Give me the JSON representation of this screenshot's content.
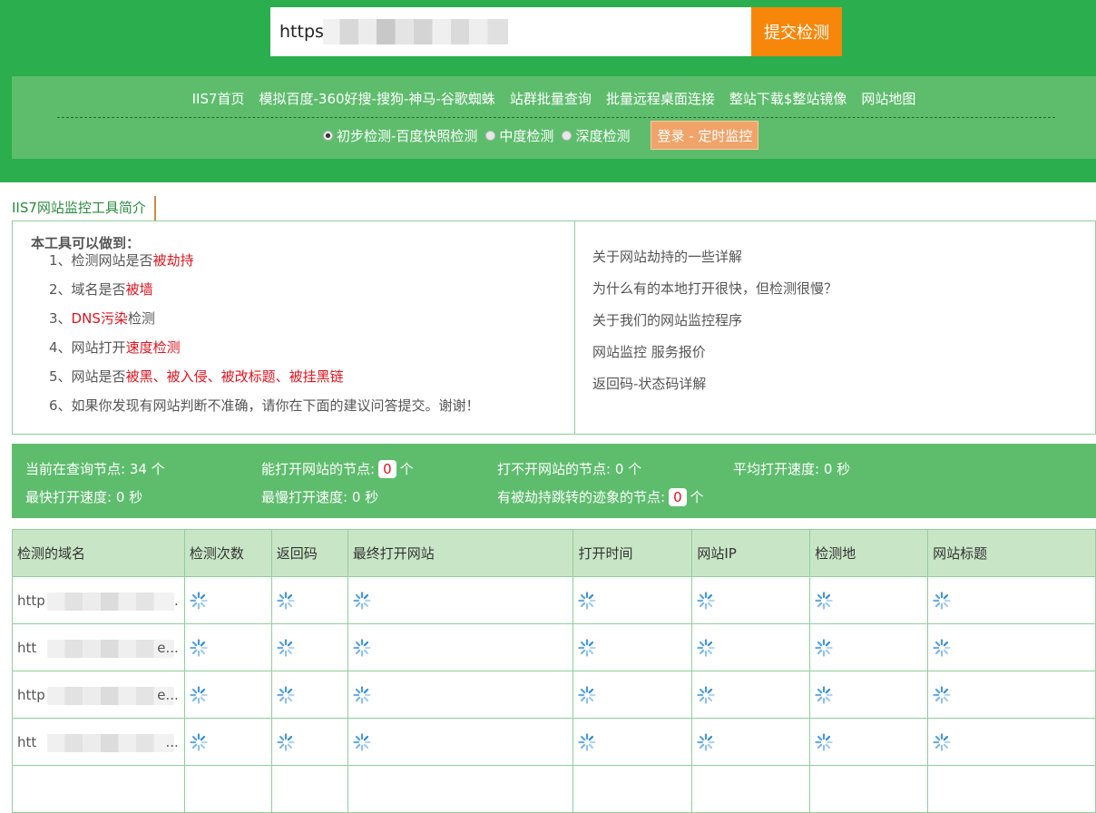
{
  "search": {
    "value": "https:",
    "submit_label": "提交检测"
  },
  "nav": {
    "links": [
      "IIS7首页",
      "模拟百度-360好搜-搜狗-神马-谷歌蜘蛛",
      "站群批量查询",
      "批量远程桌面连接",
      "整站下载$整站镜像",
      "网站地图"
    ],
    "modes": [
      {
        "label": "初步检测-百度快照检测",
        "checked": true
      },
      {
        "label": "中度检测",
        "checked": false
      },
      {
        "label": "深度检测",
        "checked": false
      }
    ],
    "login_label": "登录 - 定时监控"
  },
  "intro": {
    "tab_label": "IIS7网站监控工具简介",
    "title": "本工具可以做到：",
    "items": [
      {
        "n": "1、",
        "a": "检测网站是否",
        "b": "被劫持",
        "c": ""
      },
      {
        "n": "2、",
        "a": "域名是否",
        "b": "被墙",
        "c": ""
      },
      {
        "n": "3、",
        "a": "",
        "b": "DNS污染",
        "c": "检测"
      },
      {
        "n": "4、",
        "a": "网站打开",
        "b": "速度检测",
        "c": ""
      },
      {
        "n": "5、",
        "a": "网站是否",
        "b": "被黑、被入侵、被改标题、被挂黑链",
        "c": ""
      },
      {
        "n": "6、",
        "a": "如果你发现有网站判断不准确，请你在下面的建议问答提交。谢谢！",
        "b": "",
        "c": ""
      }
    ],
    "links": [
      "关于网站劫持的一些详解",
      "为什么有的本地打开很快，但检测很慢？",
      "关于我们的网站监控程序",
      "网站监控 服务报价",
      "返回码-状态码详解"
    ]
  },
  "stats": {
    "querying_label": "当前在查询节点: 34 个",
    "can_open_label": "能打开网站的节点:",
    "can_open_value": "0",
    "unit": "个",
    "cannot_open_label": "打不开网站的节点: 0 个",
    "avg_speed_label": "平均打开速度: 0 秒",
    "fastest_label": "最快打开速度: 0 秒",
    "slowest_label": "最慢打开速度: 0 秒",
    "hijack_label": "有被劫持跳转的迹象的节点:",
    "hijack_value": "0"
  },
  "table": {
    "headers": [
      "检测的域名",
      "检测次数",
      "返回码",
      "最终打开网站",
      "打开时间",
      "网站IP",
      "检测地",
      "网站标题"
    ],
    "rows": [
      {
        "domain_prefix": "http",
        "domain_tail": "."
      },
      {
        "domain_prefix": "htt",
        "domain_tail": "e..."
      },
      {
        "domain_prefix": "http",
        "domain_tail": "e..."
      },
      {
        "domain_prefix": "htt",
        "domain_tail": "..."
      },
      {
        "domain_prefix": "",
        "domain_tail": ""
      }
    ]
  },
  "colors": {
    "header_green": "#2bae4e",
    "panel_green": "#5ebd6d",
    "submit_orange": "#f7870b",
    "login_orange": "#f0a46a",
    "highlight_red": "#e0141e",
    "table_header": "#c8e6c6",
    "spinner_blue": "#2e8bd8"
  },
  "icons": {
    "loading": "loading-spinner-icon"
  }
}
